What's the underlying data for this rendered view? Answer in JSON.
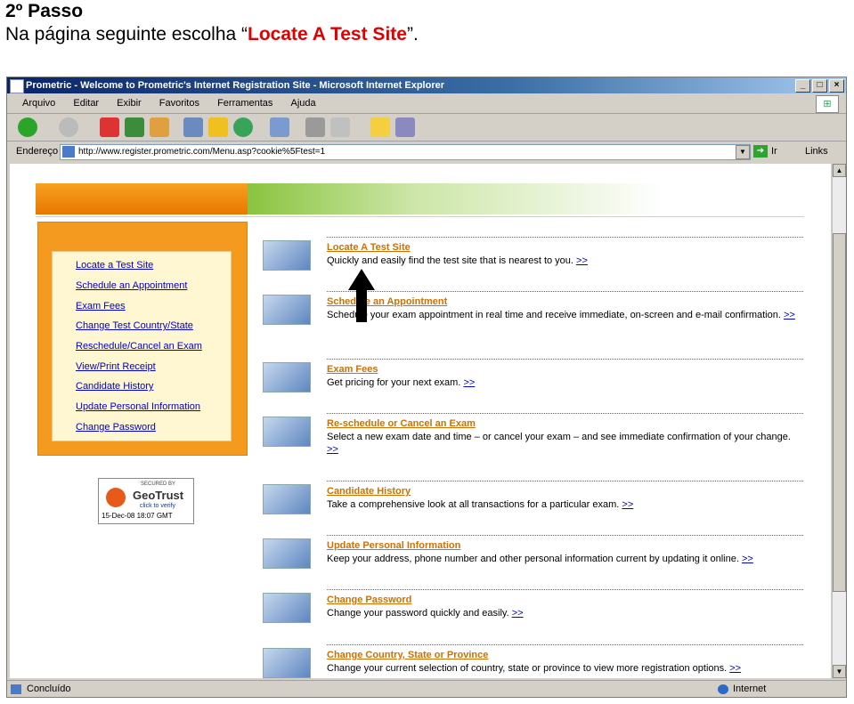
{
  "header": {
    "step": "2º Passo",
    "instruction_pre": "Na página seguinte escolha “",
    "instruction_highlight": "Locate A Test Site",
    "instruction_post": "”."
  },
  "window": {
    "title": "Prometric - Welcome to Prometric's Internet Registration Site - Microsoft Internet Explorer",
    "menu": [
      "Arquivo",
      "Editar",
      "Exibir",
      "Favoritos",
      "Ferramentas",
      "Ajuda"
    ],
    "address_label": "Endereço",
    "address": "http://www.register.prometric.com/Menu.asp?cookie%5Ftest=1",
    "go_label": "Ir",
    "links_label": "Links",
    "status": "Concluído",
    "zone": "Internet"
  },
  "sidebar": {
    "items": [
      "Locate a Test Site",
      "Schedule an Appointment",
      "Exam Fees",
      "Change Test Country/State",
      "Reschedule/Cancel an Exam",
      "View/Print Receipt",
      "Candidate History",
      "Update Personal Information",
      "Change Password"
    ]
  },
  "geotrust": {
    "secured": "SECURED BY",
    "name": "GeoTrust",
    "click": "click to verify",
    "date": "15-Dec-08 18:07 GMT"
  },
  "rows": [
    {
      "title": "Locate A Test Site",
      "desc": "Quickly and easily find the test site that is nearest to you.",
      "more": ">>"
    },
    {
      "title": "Schedule an Appointment",
      "desc": "Schedule your exam appointment in real time and receive immediate, on-screen and e-mail confirmation.",
      "more": ">>"
    },
    {
      "title": "Exam Fees",
      "desc": "Get pricing for your next exam.",
      "more": ">>"
    },
    {
      "title": "Re-schedule or Cancel an Exam",
      "desc": "Select a new exam date and time – or cancel your exam – and see immediate confirmation of your change.",
      "more": ">>"
    },
    {
      "title": "Candidate History",
      "desc": "Take a comprehensive look at all transactions for a particular exam.",
      "more": ">>"
    },
    {
      "title": "Update Personal Information",
      "desc": "Keep your address, phone number and other personal information current by updating it online.",
      "more": ">>"
    },
    {
      "title": "Change Password",
      "desc": "Change your password quickly and easily.",
      "more": ">>"
    },
    {
      "title": "Change Country, State or Province",
      "desc": "Change your current selection of country, state or province to view more registration options.",
      "more": ">>"
    }
  ]
}
